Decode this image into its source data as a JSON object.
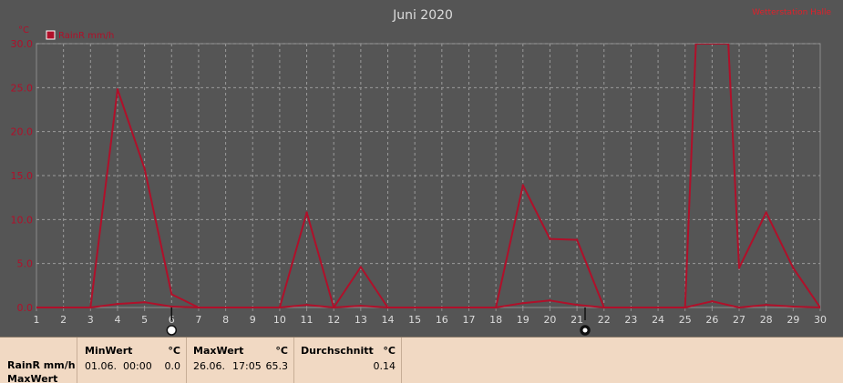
{
  "header": {
    "title": "Juni 2020",
    "corner_label": "Wetterstation Halle"
  },
  "chart_data": {
    "type": "line",
    "title": "Juni 2020",
    "yunit": "°C",
    "ylim": [
      0,
      30
    ],
    "yticks": [
      "0.0",
      "5.0",
      "10.0",
      "15.0",
      "20.0",
      "25.0",
      "30.0"
    ],
    "xlim": [
      1,
      30
    ],
    "x_ticks": [
      "1",
      "2",
      "3",
      "4",
      "5",
      "6",
      "7",
      "8",
      "9",
      "10",
      "11",
      "12",
      "13",
      "14",
      "15",
      "16",
      "17",
      "18",
      "19",
      "20",
      "21",
      "22",
      "23",
      "24",
      "25",
      "26",
      "27",
      "28",
      "29",
      "30"
    ],
    "grid": true,
    "legend": "top-left",
    "series": [
      {
        "name": "RainR mm/h",
        "color": "#b0102a",
        "x": [
          1,
          3,
          4,
          5,
          6,
          7,
          10,
          11,
          12,
          13,
          14,
          18,
          19,
          20,
          21,
          22,
          25,
          25.4,
          26.6,
          27,
          28,
          29,
          30
        ],
        "values": [
          0,
          0,
          24.8,
          15.8,
          1.5,
          0,
          0,
          10.8,
          0,
          4.6,
          0,
          0,
          13.9,
          7.8,
          7.7,
          0,
          0,
          30,
          30,
          4.5,
          10.8,
          4.5,
          0
        ]
      },
      {
        "name": "",
        "color": "#b0102a",
        "x": [
          1,
          3,
          4,
          5,
          6,
          7,
          10,
          11,
          12,
          13,
          14,
          18,
          19,
          20,
          21,
          22,
          25,
          26,
          27,
          28,
          29,
          30
        ],
        "values": [
          0,
          0,
          0.4,
          0.6,
          0.1,
          0,
          0,
          0.3,
          0,
          0.2,
          0,
          0,
          0.5,
          0.8,
          0.3,
          0,
          0,
          0.7,
          0,
          0.3,
          0.1,
          0
        ]
      }
    ],
    "markers": [
      {
        "x": 6,
        "icon": "full-moon-icon"
      },
      {
        "x": 21.3,
        "icon": "new-moon-icon"
      }
    ]
  },
  "stats": {
    "row_label": "RainR mm/h",
    "row_label_2": "MaxWert",
    "min": {
      "title": "MinWert",
      "unit": "°C",
      "date": "01.06.",
      "time": "00:00",
      "value": "0.0"
    },
    "max": {
      "title": "MaxWert",
      "unit": "°C",
      "date": "26.06.",
      "time": "17:05",
      "value": "65.3"
    },
    "avg": {
      "title": "Durchschnitt",
      "unit": "°C",
      "value": "0.14"
    }
  }
}
